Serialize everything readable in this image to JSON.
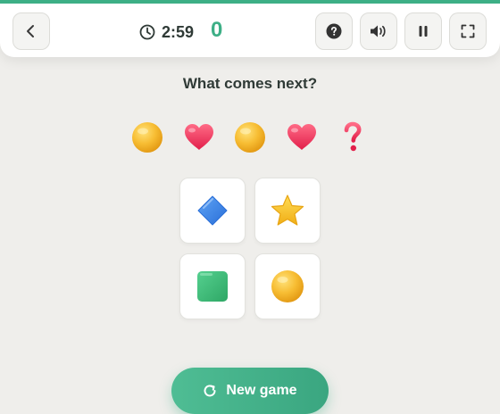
{
  "header": {
    "timer": "2:59",
    "score": "0"
  },
  "question": "What comes next?",
  "sequence": [
    {
      "icon": "coin-icon"
    },
    {
      "icon": "heart-icon"
    },
    {
      "icon": "coin-icon"
    },
    {
      "icon": "heart-icon"
    },
    {
      "icon": "question-mark-icon"
    }
  ],
  "options": [
    {
      "icon": "blue-diamond-icon"
    },
    {
      "icon": "star-icon"
    },
    {
      "icon": "green-square-icon"
    },
    {
      "icon": "coin-icon"
    }
  ],
  "new_game_label": "New game",
  "colors": {
    "accent": "#3daf86",
    "background": "#efeeeb",
    "heart": "#f03a5f",
    "coin": "#f5b92e",
    "diamond": "#3b82e6",
    "square": "#3dbd7a",
    "star": "#f7c531"
  }
}
